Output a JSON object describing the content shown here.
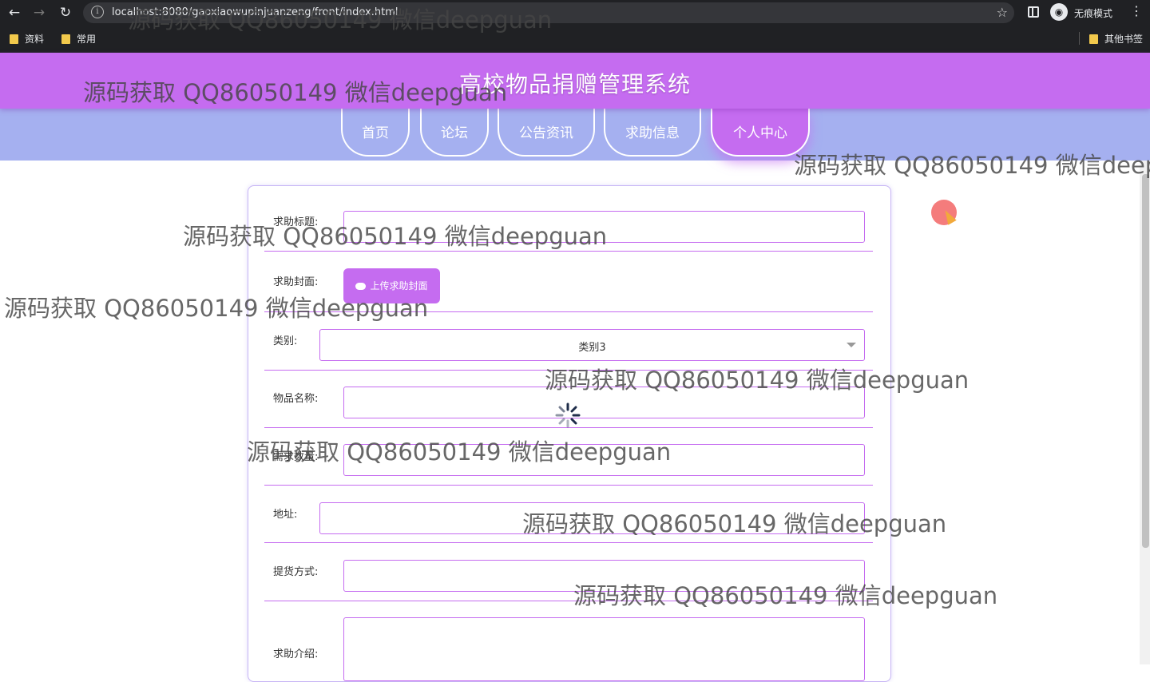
{
  "browser": {
    "url": "localhost:8080/gaoxiaowupinjuanzeng/front/index.html",
    "incognito_label": "无痕模式",
    "bookmarks": [
      "资料",
      "常用"
    ],
    "other_bookmarks": "其他书签",
    "icons": {
      "back": "arrow-left-icon",
      "forward": "arrow-right-icon",
      "reload": "reload-icon",
      "info": "info-icon",
      "star": "star-icon",
      "side_panel": "side-panel-icon",
      "incognito": "incognito-icon",
      "menu": "kebab-menu-icon",
      "folder": "folder-icon"
    }
  },
  "site": {
    "title": "高校物品捐赠管理系统",
    "nav": [
      {
        "label": "首页"
      },
      {
        "label": "论坛"
      },
      {
        "label": "公告资讯"
      },
      {
        "label": "求助信息"
      },
      {
        "label": "个人中心"
      }
    ],
    "active_nav": "个人中心"
  },
  "form": {
    "title_label": "求助标题:",
    "title_value": "",
    "cover_label": "求助封面:",
    "upload_button": "上传求助封面",
    "category_label": "类别:",
    "category_value": "类别3",
    "item_name_label": "物品名称:",
    "item_name_value": "",
    "quantity_label": "需求数量:",
    "quantity_value": "",
    "address_label": "地址:",
    "address_value": "",
    "pickup_label": "提货方式:",
    "pickup_value": "",
    "intro_label": "求助介绍:",
    "intro_value": ""
  },
  "watermark": "源码获取 QQ86050149 微信deepguan",
  "colors": {
    "header": "#c56cf0",
    "nav_band": "#a5b0f0",
    "accent": "#c56cf0",
    "chrome": "#202124",
    "click_indicator": "#f05050"
  }
}
